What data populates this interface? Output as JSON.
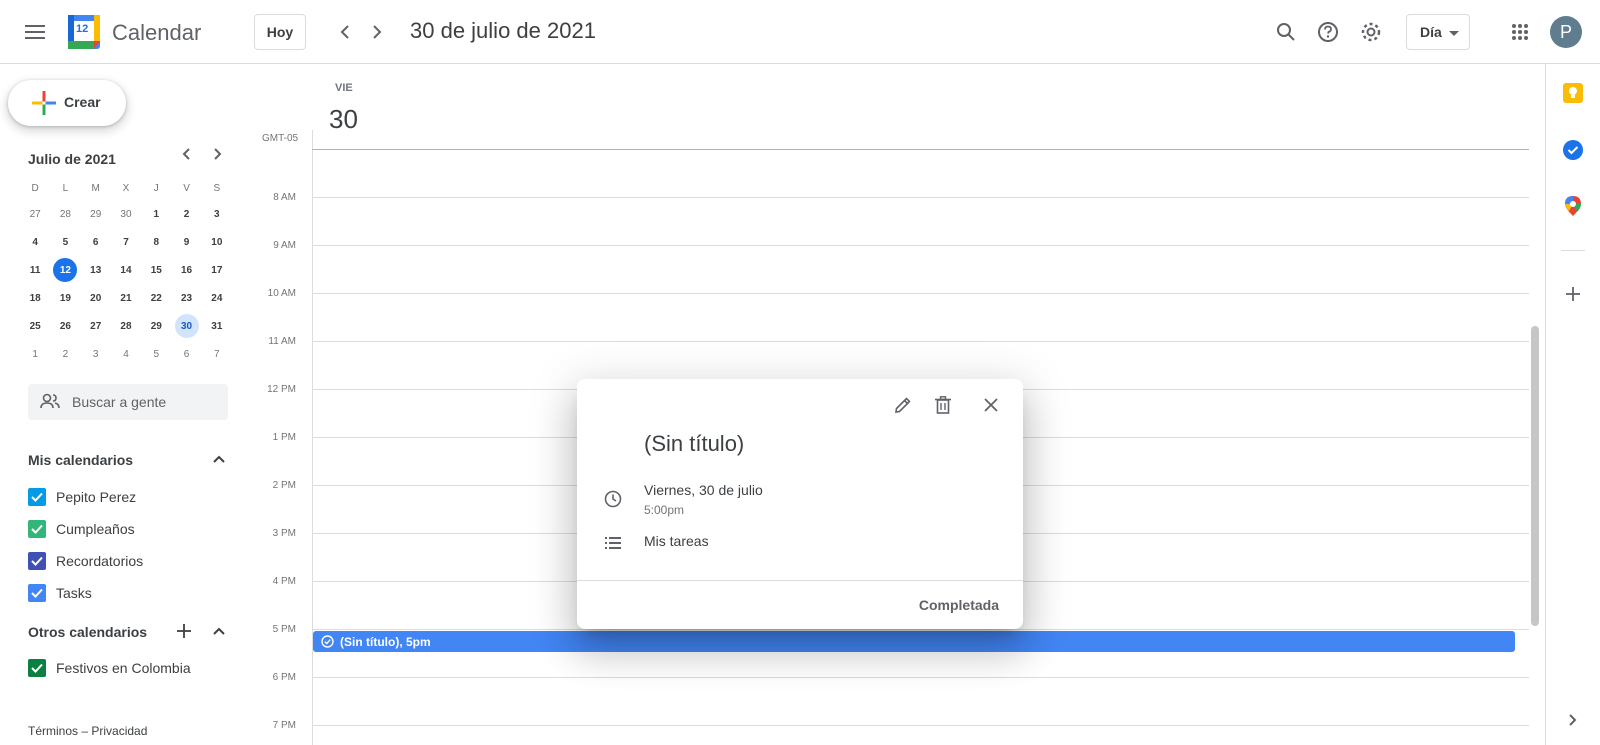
{
  "header": {
    "app_name": "Calendar",
    "logo_day": "12",
    "today_label": "Hoy",
    "date_title": "30 de julio de 2021",
    "view_label": "Día",
    "avatar_letter": "P"
  },
  "sidebar": {
    "create_label": "Crear",
    "mini_title": "Julio de 2021",
    "weekdays": [
      "D",
      "L",
      "M",
      "X",
      "J",
      "V",
      "S"
    ],
    "weeks": [
      [
        "27",
        "28",
        "29",
        "30",
        "1",
        "2",
        "3"
      ],
      [
        "4",
        "5",
        "6",
        "7",
        "8",
        "9",
        "10"
      ],
      [
        "11",
        "12",
        "13",
        "14",
        "15",
        "16",
        "17"
      ],
      [
        "18",
        "19",
        "20",
        "21",
        "22",
        "23",
        "24"
      ],
      [
        "25",
        "26",
        "27",
        "28",
        "29",
        "30",
        "31"
      ],
      [
        "1",
        "2",
        "3",
        "4",
        "5",
        "6",
        "7"
      ]
    ],
    "people_placeholder": "Buscar a gente",
    "my_calendars_title": "Mis calendarios",
    "my_calendars": [
      {
        "name": "Pepito Perez",
        "color": "#039be5"
      },
      {
        "name": "Cumpleaños",
        "color": "#33b679"
      },
      {
        "name": "Recordatorios",
        "color": "#3f51b5"
      },
      {
        "name": "Tasks",
        "color": "#4285f4"
      }
    ],
    "other_calendars_title": "Otros calendarios",
    "other_calendars": [
      {
        "name": "Festivos en Colombia",
        "color": "#0b8043"
      }
    ],
    "footer": "Términos – Privacidad"
  },
  "day_view": {
    "weekday": "VIE",
    "day_number": "30",
    "timezone": "GMT-05",
    "hours": [
      "8 AM",
      "9 AM",
      "10 AM",
      "11 AM",
      "12 PM",
      "1 PM",
      "2 PM",
      "3 PM",
      "4 PM",
      "5 PM",
      "6 PM",
      "7 PM"
    ],
    "event_label": "(Sin título), 5pm",
    "event_color": "#4285f4"
  },
  "popup": {
    "title": "(Sin título)",
    "date": "Viernes, 30 de julio",
    "time": "5:00pm",
    "list": "Mis tareas",
    "done_label": "Completada"
  }
}
